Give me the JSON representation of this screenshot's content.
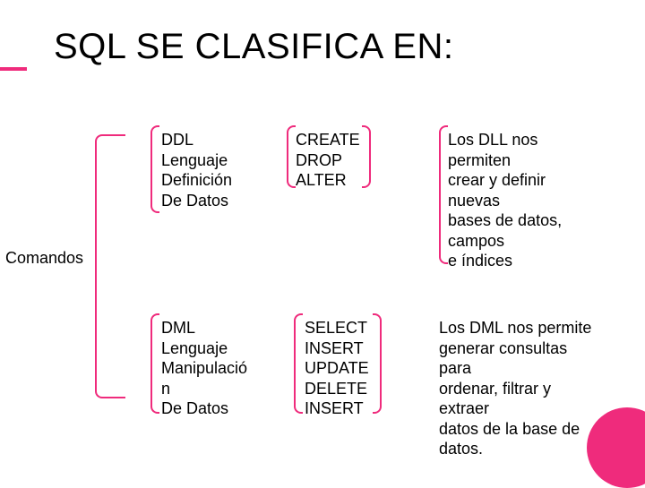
{
  "title": "SQL SE CLASIFICA EN:",
  "comandos": "Comandos",
  "ddl": "DDL\nLenguaje\nDefinición\nDe Datos",
  "dml": "DML\nLenguaje\nManipulació\nn\nDe Datos",
  "create": "CREATE\nDROP\nALTER",
  "select": "SELECT\nINSERT\nUPDATE\nDELETE\nINSERT",
  "desc1": "Los DLL nos\npermiten\ncrear y definir\nnuevas\nbases de datos,\ncampos\ne índices",
  "desc2": "Los DML nos permite\ngenerar consultas\npara\nordenar, filtrar y\nextraer\ndatos de la base de\ndatos."
}
